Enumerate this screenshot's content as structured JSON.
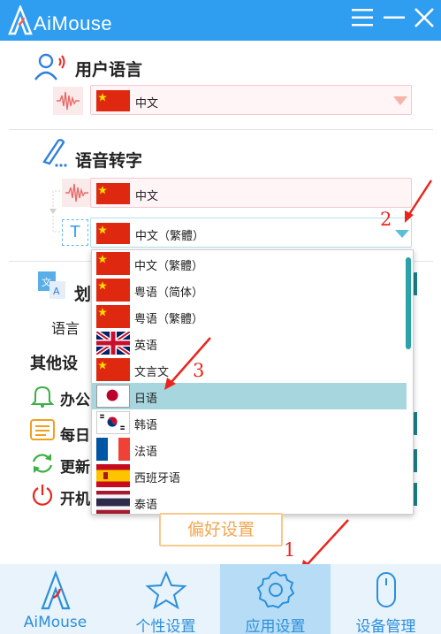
{
  "app": {
    "title": "AiMouse"
  },
  "user_language": {
    "title": "用户语言",
    "selected": "中文"
  },
  "speech_to_text": {
    "title": "语音转字",
    "source": "中文",
    "target": "中文（繁體）"
  },
  "hidden_behind": {
    "translate_title_peek": "划",
    "language_label": "语言",
    "other_settings_peek": "其他设",
    "rows": [
      "办公",
      "每日",
      "更新",
      "开机"
    ]
  },
  "dropdown": {
    "options": [
      {
        "label": "中文（繁體）",
        "flag": "cn"
      },
      {
        "label": "粤语（简体）",
        "flag": "cn"
      },
      {
        "label": "粤语（繁體）",
        "flag": "cn"
      },
      {
        "label": "英语",
        "flag": "uk"
      },
      {
        "label": "文言文",
        "flag": "cn"
      },
      {
        "label": "日语",
        "flag": "jp",
        "selected": true
      },
      {
        "label": "韩语",
        "flag": "kr"
      },
      {
        "label": "法语",
        "flag": "fr"
      },
      {
        "label": "西班牙语",
        "flag": "es"
      },
      {
        "label": "泰语",
        "flag": "th"
      }
    ]
  },
  "preferences_button": "偏好设置",
  "annotations": [
    "1",
    "2",
    "3"
  ],
  "bottom_nav": [
    {
      "label": "AiMouse",
      "icon": "aimouse-logo-icon"
    },
    {
      "label": "个性设置",
      "icon": "star-icon"
    },
    {
      "label": "应用设置",
      "icon": "gear-icon",
      "active": true
    },
    {
      "label": "设备管理",
      "icon": "mouse-icon"
    }
  ],
  "colors": {
    "accent": "#2f9ef0",
    "annotation": "#e8261e",
    "selected_row": "#a8d6de",
    "pref_button": "#f3a552"
  }
}
